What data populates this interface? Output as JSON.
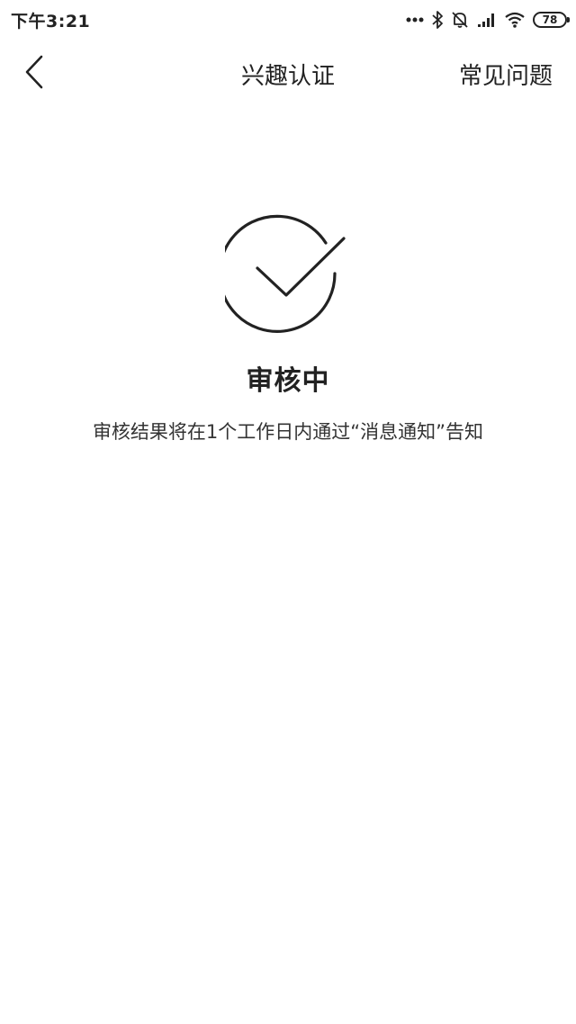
{
  "status_bar": {
    "time": "下午3:21",
    "icons": [
      "more-dots-icon",
      "bluetooth-icon",
      "mute-bell-icon",
      "signal-icon",
      "wifi-icon"
    ],
    "battery_level": "78"
  },
  "nav": {
    "back_icon": "chevron-left-icon",
    "title": "兴趣认证",
    "faq_label": "常见问题"
  },
  "main": {
    "graphic_icon": "check-circle-icon",
    "heading": "审核中",
    "message": "审核结果将在1个工作日内通过“消息通知”告知"
  },
  "colors": {
    "text": "#222222",
    "background": "#ffffff"
  }
}
